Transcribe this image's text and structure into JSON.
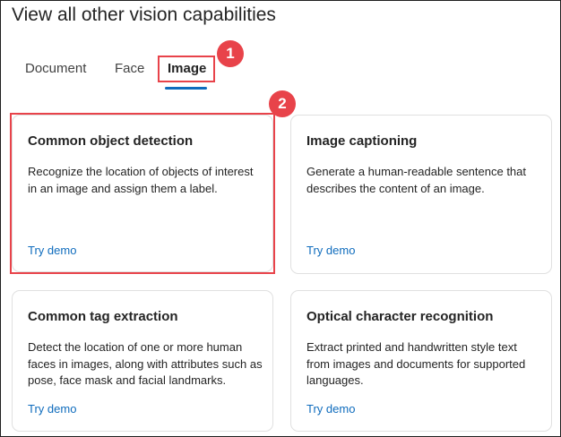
{
  "page": {
    "title": "View all other vision capabilities"
  },
  "tabs": [
    {
      "label": "Document"
    },
    {
      "label": "Face"
    },
    {
      "label": "Image",
      "selected": true
    }
  ],
  "callouts": [
    {
      "number": "1"
    },
    {
      "number": "2"
    }
  ],
  "cards": [
    {
      "title": "Common object detection",
      "description": "Recognize the location of objects of interest in an image and assign them a label.",
      "link": "Try demo"
    },
    {
      "title": "Image captioning",
      "description": "Generate a human-readable sentence that describes the content of an image.",
      "link": "Try demo"
    },
    {
      "title": "Common tag extraction",
      "description": "Detect the location of one or more human faces in images, along with attributes such as pose, face mask and facial landmarks.",
      "link": "Try demo"
    },
    {
      "title": "Optical character recognition",
      "description": "Extract printed and handwritten style text from images and documents for supported languages.",
      "link": "Try demo"
    }
  ],
  "colors": {
    "accent": "#0f6cbd",
    "callout": "#e8434a",
    "card_border": "#e0e0e0"
  }
}
